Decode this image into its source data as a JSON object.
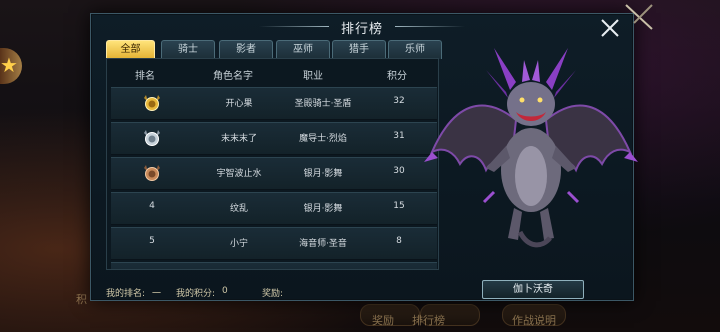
{
  "panel": {
    "title": "排行榜"
  },
  "tabs": [
    {
      "label": "全部",
      "active": true
    },
    {
      "label": "骑士",
      "active": false
    },
    {
      "label": "影者",
      "active": false
    },
    {
      "label": "巫师",
      "active": false
    },
    {
      "label": "猎手",
      "active": false
    },
    {
      "label": "乐师",
      "active": false
    }
  ],
  "columns": [
    "排名",
    "角色名字",
    "职业",
    "积分"
  ],
  "rows": [
    {
      "rank": "1",
      "badge": "gold-medal-icon",
      "name": "开心果",
      "job": "圣殿骑士·圣盾",
      "score": "32"
    },
    {
      "rank": "2",
      "badge": "silver-medal-icon",
      "name": "末末末了",
      "job": "魔导士·烈焰",
      "score": "31"
    },
    {
      "rank": "3",
      "badge": "bronze-medal-icon",
      "name": "宇智波止水",
      "job": "银月·影舞",
      "score": "30"
    },
    {
      "rank": "4",
      "badge": "",
      "name": "纹乱",
      "job": "银月·影舞",
      "score": "15"
    },
    {
      "rank": "5",
      "badge": "",
      "name": "小宁",
      "job": "海音师·圣音",
      "score": "8"
    }
  ],
  "footer": {
    "my_rank_label": "我的排名:",
    "my_rank_value": "一",
    "my_score_label": "我的积分:",
    "my_score_value": "0",
    "reward_label": "奖励:"
  },
  "hero_button": {
    "label": "伽卜沃奇"
  },
  "background": {
    "bottom_left": "积",
    "bottom_labels": [
      "奖励",
      "排行榜",
      "作战说明"
    ]
  },
  "colors": {
    "tab_active": "#f2c94c",
    "panel_bg": "#0e1d27",
    "border": "#3c5866"
  }
}
